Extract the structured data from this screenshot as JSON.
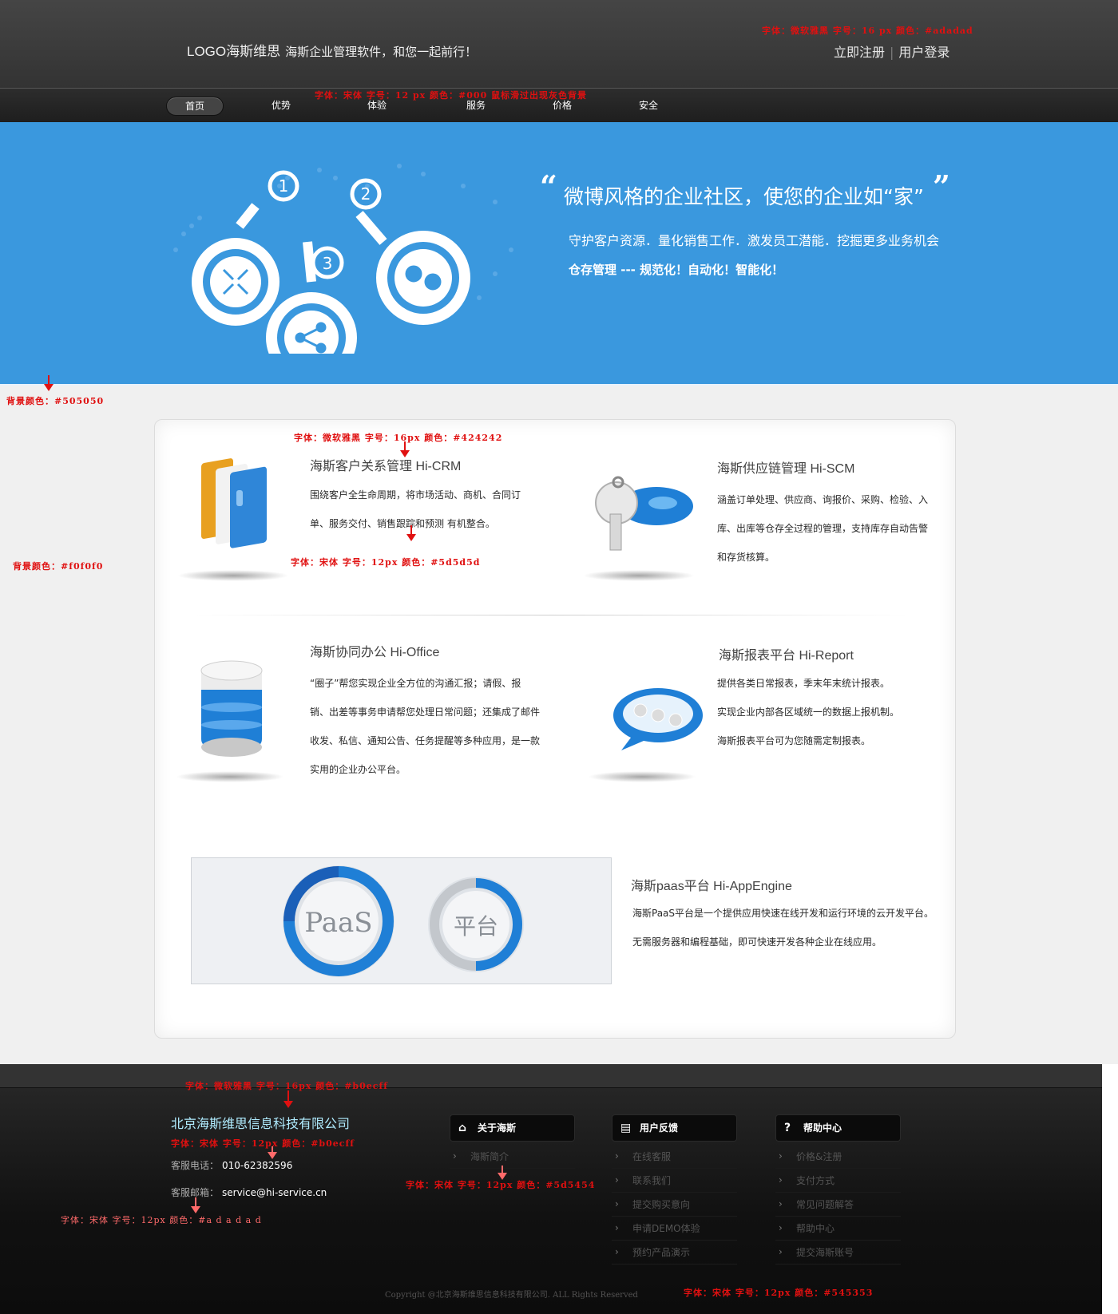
{
  "header": {
    "logo_text": "LOGO海斯维思",
    "slogan": "海斯企业管理软件，和您一起前行！",
    "register_label": "立即注册",
    "separator": "|",
    "login_label": "用户登录"
  },
  "nav": {
    "items": [
      {
        "label": "首页"
      },
      {
        "label": "优势"
      },
      {
        "label": "体验"
      },
      {
        "label": "服务"
      },
      {
        "label": "价格"
      },
      {
        "label": "安全"
      }
    ]
  },
  "banner": {
    "open_quote": "“",
    "title": "微博风格的企业社区，使您的企业如“家”",
    "close_quote": "”",
    "subtitle1": "守护客户资源．量化销售工作．激发员工潜能．挖掘更多业务机会",
    "subtitle2": "仓存管理 --- 规范化！自动化！智能化！",
    "numbers": [
      "1",
      "2",
      "3"
    ]
  },
  "products": [
    {
      "title": "海斯客户关系管理  Hi-CRM",
      "lines": [
        "围绕客户全生命周期，将市场活动、商机、合同订",
        "单、服务交付、销售跟踪和预测 有机整合。"
      ]
    },
    {
      "title": "海斯供应链管理  Hi-SCM",
      "lines": [
        "涵盖订单处理、供应商、询报价、采购、检验、入",
        "库、出库等仓存全过程的管理，支持库存自动告警",
        "和存货核算。"
      ]
    },
    {
      "title": "海斯协同办公 Hi-Office",
      "lines": [
        "“圈子”帮您实现企业全方位的沟通汇报；请假、报",
        "销、出差等事务申请帮您处理日常问题；还集成了邮件",
        "收发、私信、通知公告、任务提醒等多种应用，是一款",
        "实用的企业办公平台。"
      ]
    },
    {
      "title": "海斯报表平台 Hi-Report",
      "lines": [
        "提供各类日常报表，季末年末统计报表。",
        "实现企业内部各区域统一的数据上报机制。",
        "海斯报表平台可为您随需定制报表。"
      ]
    },
    {
      "title": "海斯paas平台 Hi-AppEngine",
      "lines": [
        "海斯PaaS平台是一个提供应用快速在线开发和运行环境的云开发平台。",
        "无需服务器和编程基础，即可快速开发各种企业在线应用。"
      ]
    }
  ],
  "paas_badges": {
    "left": "PaaS",
    "right": "平台"
  },
  "footer": {
    "company": "北京海斯维思信息科技有限公司",
    "phone_label": "客服电话：",
    "phone": "010-62382596",
    "email_label": "客服邮箱：",
    "email": "service@hi-service.cn",
    "columns": [
      {
        "title": "关于海斯",
        "icon": "home-icon",
        "items": [
          "海斯简介"
        ]
      },
      {
        "title": "用户反馈",
        "icon": "document-icon",
        "items": [
          "在线客服",
          "联系我们",
          "提交购买意向",
          "申请DEMO体验",
          "预约产品演示"
        ]
      },
      {
        "title": "帮助中心",
        "icon": "question-icon",
        "items": [
          "价格&注册",
          "支付方式",
          "常见问题解答",
          "帮助中心",
          "提交海斯账号"
        ]
      }
    ],
    "copyright": "Copyright @北京海斯维思信息科技有限公司. ALL Rights Reserved"
  },
  "annotations": {
    "header_font": "字体：微软雅黑  字号：16 px   颜色：#adadad",
    "nav_font": "字体：宋体  字号：12 px   颜色：#000  鼠标滑过出现灰色背景",
    "banner_bg": "背景颜色：#505050",
    "content_bg": "背景颜色：#f0f0f0",
    "title_font": "字体：微软雅黑  字号：16px   颜色：#424242",
    "desc_font": "字体：宋体  字号：12px    颜色：#5d5d5d",
    "company_font": "字体：微软雅黑   字号：16px   颜色：#b0ecff",
    "phone_font": "字体：宋体   字号：12px   颜色：#b0ecff",
    "contact_font": "字体：宋体   字号：12px   颜色：#a d a d a d",
    "footer_list_font": "字体：宋体   字号：12px   颜色：#5d5454",
    "copyright_font": "字体：宋体   字号：12px   颜色：#545353"
  },
  "colors": {
    "banner": "#3a98de",
    "content_bg": "#f0f0f0",
    "title": "#424242",
    "footer_company": "#b0ecff",
    "footer_text": "#adadad",
    "footer_list": "#545454",
    "copyright": "#545353"
  }
}
